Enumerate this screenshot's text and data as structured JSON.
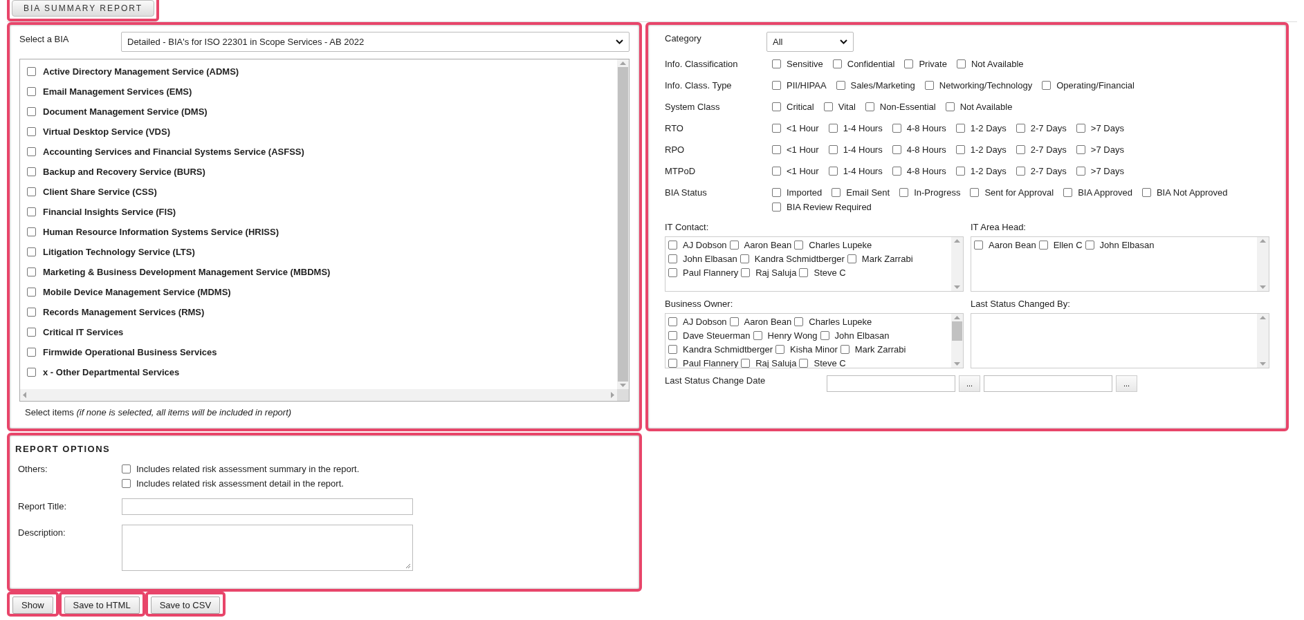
{
  "tab": {
    "label": "BIA SUMMARY REPORT",
    "selected": true
  },
  "bia_panel": {
    "select_label": "Select a BIA",
    "select_value": "Detailed - BIA's for ISO 22301 in Scope Services - AB 2022",
    "items": [
      {
        "label": "Active Directory Management Service (ADMS)",
        "checked": false
      },
      {
        "label": "Email Management Services (EMS)",
        "checked": false
      },
      {
        "label": "Document Management Service (DMS)",
        "checked": false
      },
      {
        "label": "Virtual Desktop Service (VDS)",
        "checked": false
      },
      {
        "label": "Accounting Services and Financial Systems Service (ASFSS)",
        "checked": false
      },
      {
        "label": "Backup and Recovery Service (BURS)",
        "checked": false
      },
      {
        "label": "Client Share Service (CSS)",
        "checked": false
      },
      {
        "label": "Financial Insights Service (FIS)",
        "checked": false
      },
      {
        "label": "Human Resource Information Systems Service (HRISS)",
        "checked": false
      },
      {
        "label": "Litigation Technology Service (LTS)",
        "checked": false
      },
      {
        "label": "Marketing & Business Development Management Service (MBDMS)",
        "checked": false
      },
      {
        "label": "Mobile Device Management Service (MDMS)",
        "checked": false
      },
      {
        "label": "Records Management Services (RMS)",
        "checked": false
      },
      {
        "label": "Critical IT Services",
        "checked": false
      },
      {
        "label": "Firmwide Operational Business Services",
        "checked": false
      },
      {
        "label": "x - Other Departmental Services",
        "checked": false
      }
    ],
    "hint": "Select items *(if none is selected, all items will be included in report)*"
  },
  "filters": {
    "category": {
      "label": "Category",
      "value": "All"
    },
    "groups": [
      {
        "label": "Info. Classification",
        "options": [
          {
            "label": "Sensitive",
            "checked": false
          },
          {
            "label": "Confidential",
            "checked": false
          },
          {
            "label": "Private",
            "checked": false
          },
          {
            "label": "Not Available",
            "checked": false
          }
        ]
      },
      {
        "label": "Info. Class. Type",
        "options": [
          {
            "label": "PII/HIPAA",
            "checked": false
          },
          {
            "label": "Sales/Marketing",
            "checked": false
          },
          {
            "label": "Networking/Technology",
            "checked": false
          },
          {
            "label": "Operating/Financial",
            "checked": false
          }
        ]
      },
      {
        "label": "System Class",
        "options": [
          {
            "label": "Critical",
            "checked": false
          },
          {
            "label": "Vital",
            "checked": false
          },
          {
            "label": "Non-Essential",
            "checked": false
          },
          {
            "label": "Not Available",
            "checked": false
          }
        ]
      },
      {
        "label": "RTO",
        "options": [
          {
            "label": "<1 Hour",
            "checked": false
          },
          {
            "label": "1-4 Hours",
            "checked": false
          },
          {
            "label": "4-8 Hours",
            "checked": false
          },
          {
            "label": "1-2 Days",
            "checked": false
          },
          {
            "label": "2-7 Days",
            "checked": false
          },
          {
            "label": ">7 Days",
            "checked": false
          }
        ]
      },
      {
        "label": "RPO",
        "options": [
          {
            "label": "<1 Hour",
            "checked": false
          },
          {
            "label": "1-4 Hours",
            "checked": false
          },
          {
            "label": "4-8 Hours",
            "checked": false
          },
          {
            "label": "1-2 Days",
            "checked": false
          },
          {
            "label": "2-7 Days",
            "checked": false
          },
          {
            "label": ">7 Days",
            "checked": false
          }
        ]
      },
      {
        "label": "MTPoD",
        "options": [
          {
            "label": "<1 Hour",
            "checked": false
          },
          {
            "label": "1-4 Hours",
            "checked": false
          },
          {
            "label": "4-8 Hours",
            "checked": false
          },
          {
            "label": "1-2 Days",
            "checked": false
          },
          {
            "label": "2-7 Days",
            "checked": false
          },
          {
            "label": ">7 Days",
            "checked": false
          }
        ]
      },
      {
        "label": "BIA Status",
        "options": [
          {
            "label": "Imported",
            "checked": false
          },
          {
            "label": "Email Sent",
            "checked": false
          },
          {
            "label": "In-Progress",
            "checked": false
          },
          {
            "label": "Sent for Approval",
            "checked": false
          },
          {
            "label": "BIA Approved",
            "checked": false
          },
          {
            "label": "BIA Not Approved",
            "checked": false
          },
          {
            "label": "BIA Review Required",
            "checked": false
          }
        ]
      }
    ],
    "people": [
      {
        "label": "IT Contact:",
        "rows": [
          [
            {
              "label": "AJ Dobson",
              "checked": false
            },
            {
              "label": "Aaron Bean",
              "checked": false
            },
            {
              "label": "Charles Lupeke",
              "checked": false
            }
          ],
          [
            {
              "label": "John Elbasan",
              "checked": false
            },
            {
              "label": "Kandra Schmidtberger",
              "checked": false
            },
            {
              "label": "Mark Zarrabi",
              "checked": false
            }
          ],
          [
            {
              "label": "Paul Flannery",
              "checked": false
            },
            {
              "label": "Raj Saluja",
              "checked": false
            },
            {
              "label": "Steve C",
              "checked": false
            }
          ]
        ]
      },
      {
        "label": "IT Area Head:",
        "rows": [
          [
            {
              "label": "Aaron Bean",
              "checked": false
            },
            {
              "label": "Ellen C",
              "checked": false
            },
            {
              "label": "John Elbasan",
              "checked": false
            }
          ]
        ]
      },
      {
        "label": "Business Owner:",
        "rows": [
          [
            {
              "label": "AJ Dobson",
              "checked": false
            },
            {
              "label": "Aaron Bean",
              "checked": false
            },
            {
              "label": "Charles Lupeke",
              "checked": false
            }
          ],
          [
            {
              "label": "Dave Steuerman",
              "checked": false
            },
            {
              "label": "Henry Wong",
              "checked": false
            },
            {
              "label": "John Elbasan",
              "checked": false
            }
          ],
          [
            {
              "label": "Kandra Schmidtberger",
              "checked": false
            },
            {
              "label": "Kisha Minor",
              "checked": false
            },
            {
              "label": "Mark Zarrabi",
              "checked": false
            }
          ],
          [
            {
              "label": "Paul Flannery",
              "checked": false
            },
            {
              "label": "Raj Saluja",
              "checked": false
            },
            {
              "label": "Steve C",
              "checked": false
            }
          ]
        ]
      },
      {
        "label": "Last Status Changed By:"
      }
    ],
    "date": {
      "label": "Last Status Change Date",
      "buttons": [
        "...",
        "..."
      ]
    }
  },
  "report_options": {
    "title": "REPORT OPTIONS",
    "others_label": "Others:",
    "others": [
      {
        "label": "Includes related risk assessment summary in the report.",
        "checked": false
      },
      {
        "label": "Includes related risk assessment detail in the report.",
        "checked": false
      }
    ],
    "fields": [
      {
        "label": "Report Title:",
        "kind": "input"
      },
      {
        "label": "Description:",
        "kind": "textarea"
      }
    ]
  },
  "buttons": [
    "Show",
    "Save to HTML",
    "Save to CSV"
  ]
}
